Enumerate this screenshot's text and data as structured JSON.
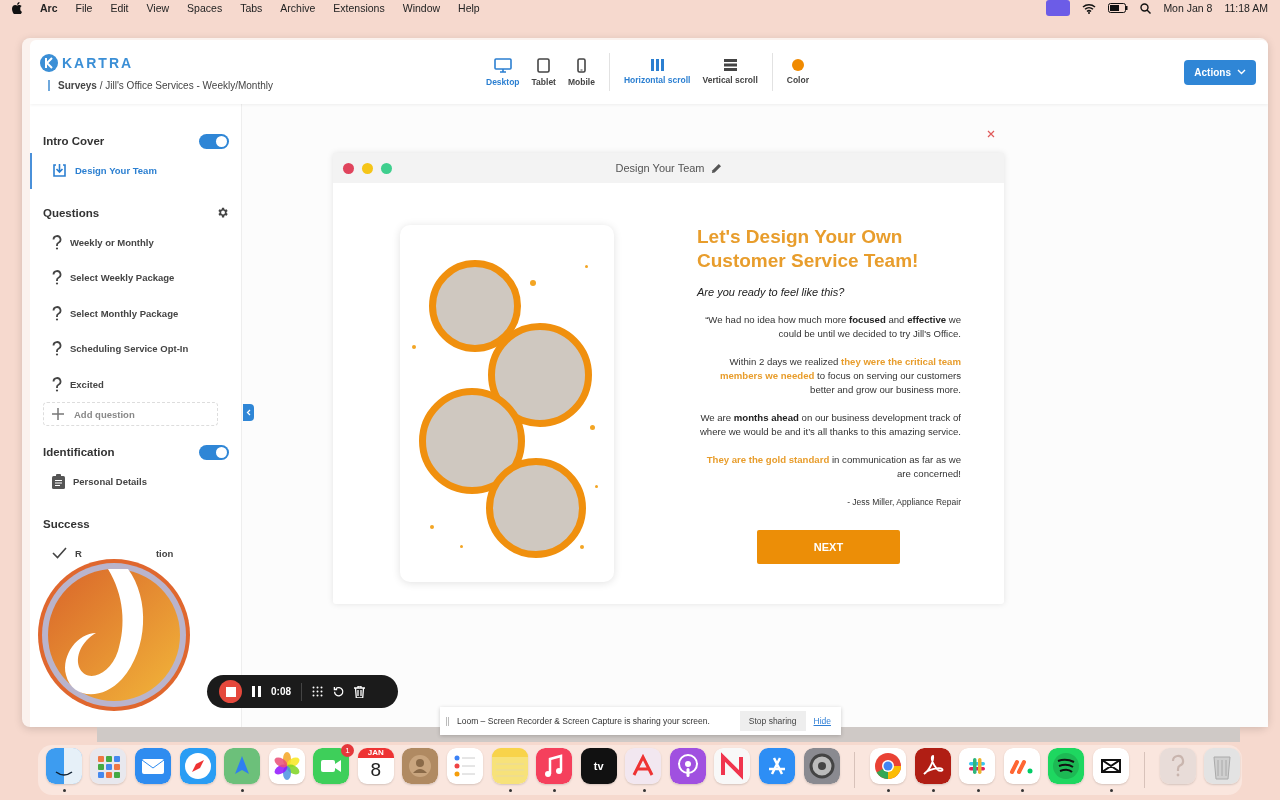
{
  "menu_bar": {
    "app": "Arc",
    "menus": [
      "File",
      "Edit",
      "View",
      "Spaces",
      "Tabs",
      "Archive",
      "Extensions",
      "Window",
      "Help"
    ],
    "date": "Mon Jan 8",
    "time": "11:18 AM"
  },
  "header": {
    "logo": "KARTRA",
    "breadcrumb": "**Surveys** / Jill's Office Services - Weekly/Monthly",
    "devices": [
      {
        "label": "Desktop",
        "kind": "desktop",
        "selected": true
      },
      {
        "label": "Tablet",
        "kind": "tablet",
        "selected": false
      },
      {
        "label": "Mobile",
        "kind": "mobile",
        "selected": false
      }
    ],
    "scroll_modes": [
      {
        "label": "Horizontal scroll",
        "kind": "horizontal",
        "selected": true
      },
      {
        "label": "Vertical scroll",
        "kind": "vertical",
        "selected": false
      }
    ],
    "color_picker": {
      "label": "Color",
      "color": "#f08a00"
    },
    "actions": "Actions"
  },
  "sidebar": {
    "sections": [
      {
        "title": "Intro Cover",
        "kind": "toggle",
        "on": true,
        "items": [
          {
            "label": "Design Your Team",
            "kind": "cover",
            "selected": true
          }
        ]
      },
      {
        "title": "Questions",
        "kind": "settings",
        "add_label": "Add question",
        "items": [
          {
            "label": "Weekly or Monthly",
            "kind": "question",
            "selected": false
          },
          {
            "label": "Select Weekly Package",
            "kind": "question",
            "selected": false
          },
          {
            "label": "Select Monthly Package",
            "kind": "question",
            "selected": false
          },
          {
            "label": "Scheduling Service Opt-In",
            "kind": "question",
            "selected": false
          },
          {
            "label": "Excited",
            "kind": "question",
            "selected": false
          }
        ]
      },
      {
        "title": "Identification",
        "kind": "toggle",
        "on": true,
        "items": [
          {
            "label": "Personal Details",
            "kind": "form",
            "selected": false
          }
        ]
      },
      {
        "title": "Success",
        "kind": "plain",
        "items": [
          {
            "label_parts": [
              "R",
              "tion"
            ],
            "kind": "check",
            "selected": false
          }
        ]
      }
    ]
  },
  "preview": {
    "title": "Design Your Team",
    "heading": "Let's Design Your Own Customer Service Team!",
    "subheading": "Are you ready to feel like this?",
    "paragraphs": [
      [
        {
          "text": "“We had no idea how much more ",
          "kind": "plain"
        },
        {
          "text": "focused",
          "kind": "bold"
        },
        {
          "text": " and ",
          "kind": "plain"
        },
        {
          "text": "effective",
          "kind": "bold"
        },
        {
          "text": " we could be until we decided to try Jill's Office.",
          "kind": "plain"
        }
      ],
      [
        {
          "text": "Within 2 days we realized ",
          "kind": "plain"
        },
        {
          "text": "they were the critical team members we needed",
          "kind": "highlight"
        },
        {
          "text": " to focus on serving our customers better and grow our business more.",
          "kind": "plain"
        }
      ],
      [
        {
          "text": "We are ",
          "kind": "plain"
        },
        {
          "text": "months ahead",
          "kind": "bold"
        },
        {
          "text": " on our business development track of where we would be and it’s all thanks to this amazing service.",
          "kind": "plain"
        }
      ],
      [
        {
          "text": "They are the gold standard",
          "kind": "highlight"
        },
        {
          "text": " in communication as far as we are concerned!",
          "kind": "plain"
        }
      ]
    ],
    "attribution": "- Jess Miller, Appliance Repair",
    "button": "NEXT"
  },
  "recorder": {
    "time": "0:08"
  },
  "notification": {
    "message": "Loom – Screen Recorder & Screen Capture is sharing your screen.",
    "stop": "Stop sharing",
    "hide": "Hide"
  },
  "dock": [
    {
      "kind": "finder",
      "color": "#3d9cf0",
      "running": true
    },
    {
      "kind": "launchpad",
      "color": "#e8e8ee",
      "running": false
    },
    {
      "kind": "mail",
      "color": "#2f8cf0",
      "running": false
    },
    {
      "kind": "safari",
      "color": "#2a9df4",
      "running": false
    },
    {
      "kind": "maps",
      "color": "#6cc07a",
      "running": true
    },
    {
      "kind": "photos",
      "color": "#ffffff",
      "running": false
    },
    {
      "kind": "facetime",
      "color": "#3ecf5a",
      "running": false,
      "badge": "1"
    },
    {
      "kind": "calendar",
      "color": "#ffffff",
      "running": false,
      "month": "JAN",
      "day": "8"
    },
    {
      "kind": "contacts",
      "color": "#b08a62",
      "running": false
    },
    {
      "kind": "reminders",
      "color": "#ffffff",
      "running": false
    },
    {
      "kind": "notes",
      "color": "#f7e27a",
      "running": true
    },
    {
      "kind": "music",
      "color": "#f5405c",
      "running": true
    },
    {
      "kind": "tv",
      "color": "#111111",
      "running": false,
      "label": "tv"
    },
    {
      "kind": "arc",
      "color": "#f2e7f0",
      "running": true
    },
    {
      "kind": "podcasts",
      "color": "#a050e0",
      "running": false
    },
    {
      "kind": "news",
      "color": "#f8f8f8",
      "running": false
    },
    {
      "kind": "appstore",
      "color": "#2d8ef5",
      "running": false
    },
    {
      "kind": "settings",
      "color": "#8a8a90",
      "running": false
    },
    {
      "kind": "chrome",
      "color": "#ffffff",
      "running": true,
      "divider_before": true
    },
    {
      "kind": "acrobat",
      "color": "#b01e14",
      "running": true
    },
    {
      "kind": "slack",
      "color": "#ffffff",
      "running": true
    },
    {
      "kind": "monday",
      "color": "#ffffff",
      "running": true
    },
    {
      "kind": "spotify",
      "color": "#1ed760",
      "running": false
    },
    {
      "kind": "capcut",
      "color": "#ffffff",
      "running": true
    },
    {
      "kind": "help",
      "color": "#e8dcd8",
      "running": false,
      "divider_before": true
    },
    {
      "kind": "trash",
      "color": "#e3e3e3",
      "running": false
    }
  ]
}
